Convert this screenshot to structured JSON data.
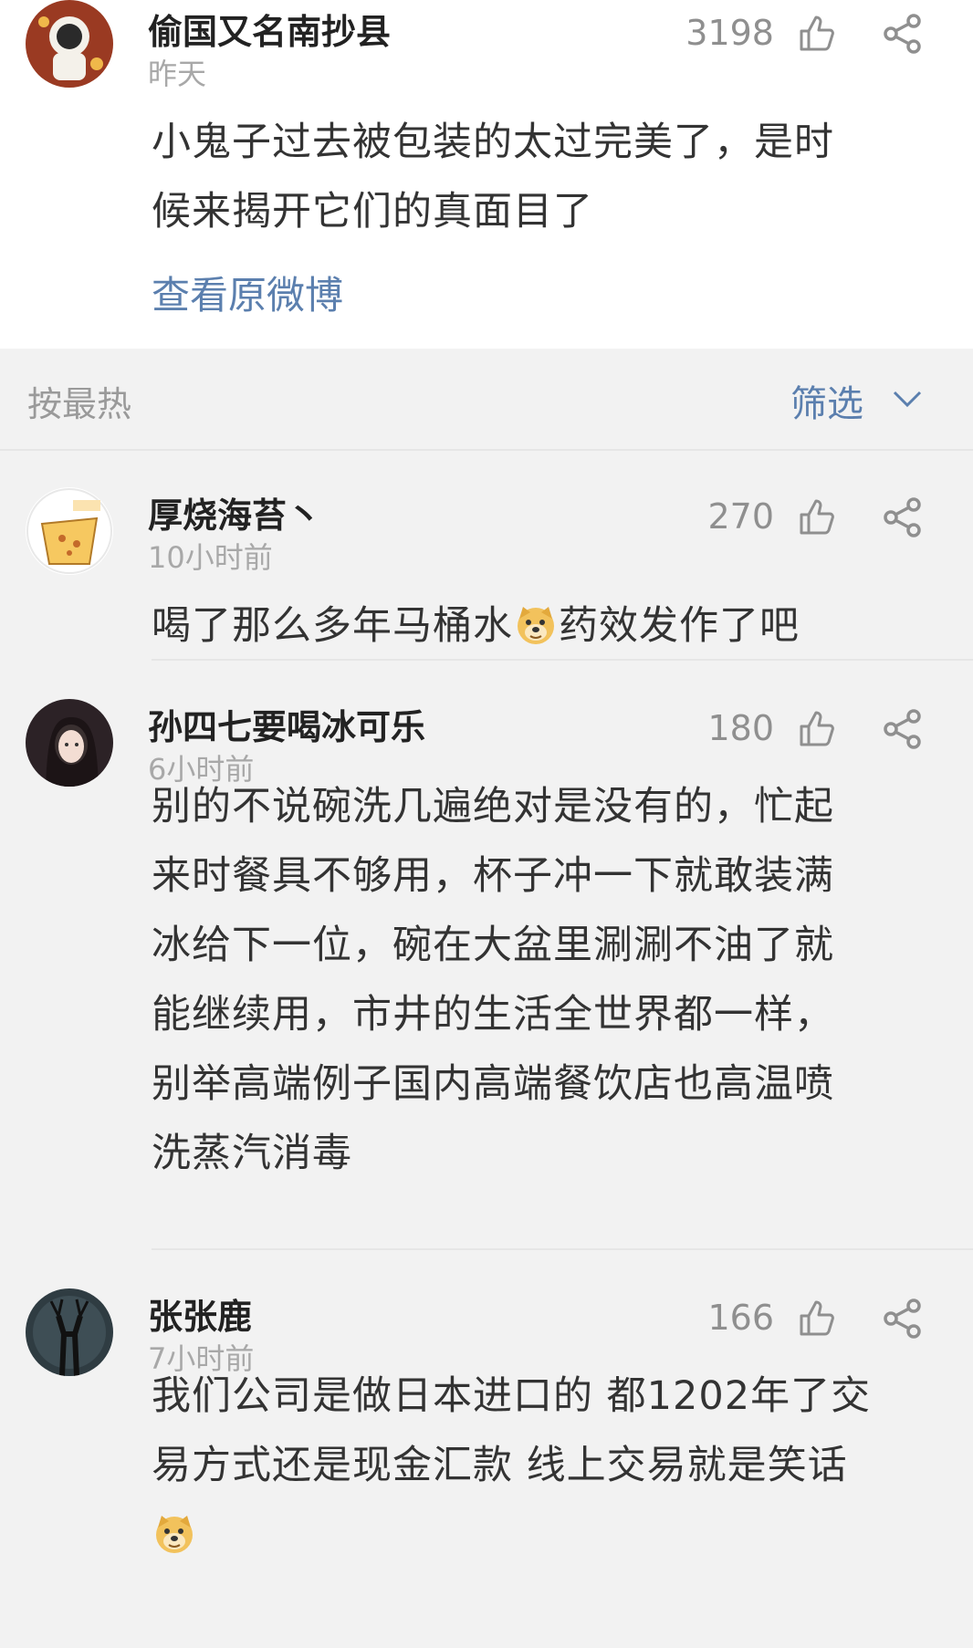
{
  "post": {
    "user": "偷国又名南抄县",
    "time": "昨天",
    "likes": "3198",
    "text_line1": "小鬼子过去被包装的太过完美了，是时",
    "text_line2": "候来揭开它们的真面目了",
    "view_original": "查看原微博"
  },
  "sort": {
    "label": "按最热",
    "filter_label": "筛选"
  },
  "comments": [
    {
      "user": "厚烧海苔丶",
      "time": "10小时前",
      "likes": "270",
      "text_before_emoji": "喝了那么多年马桶水",
      "text_after_emoji": "药效发作了吧"
    },
    {
      "user": "孙四七要喝冰可乐",
      "time": "6小时前",
      "likes": "180",
      "lines": [
        "别的不说碗洗几遍绝对是没有的，忙起",
        "来时餐具不够用，杯子冲一下就敢装满",
        "冰给下一位，碗在大盆里涮涮不油了就",
        "能继续用，市井的生活全世界都一样，",
        "别举高端例子国内高端餐饮店也高温喷",
        "洗蒸汽消毒"
      ]
    },
    {
      "user": "张张鹿",
      "time": "7小时前",
      "likes": "166",
      "lines": [
        "我们公司是做日本进口的 都1202年了交",
        "易方式还是现金汇款 线上交易就是笑话"
      ]
    }
  ],
  "icons": {
    "like": "thumbs-up-outline-icon",
    "share": "share-nodes-icon",
    "chevron": "chevron-down-icon",
    "emoji": "doge-emoji"
  },
  "colors": {
    "link_blue": "#5b7fae",
    "meta_gray": "#a8a8a8",
    "background": "#f2f2f2"
  }
}
